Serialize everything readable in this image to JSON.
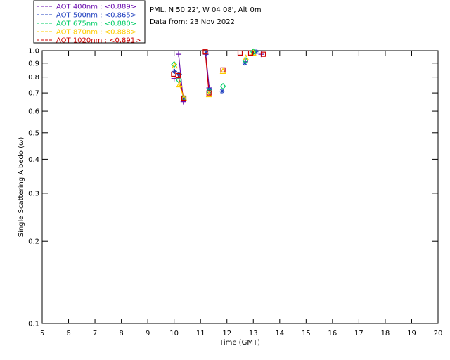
{
  "info": {
    "site": "PML, N 50 22', W 04 08', Alt 0m",
    "date": "Data from: 23 Nov 2022"
  },
  "legend": [
    {
      "label": "AOT  400nm : <0.889>",
      "color": "#6a0dad"
    },
    {
      "label": "AOT  500nm : <0.865>",
      "color": "#1f3fbf"
    },
    {
      "label": "AOT  675nm : <0.880>",
      "color": "#00cc66"
    },
    {
      "label": "AOT  870nm : <0.888>",
      "color": "#ffcc00"
    },
    {
      "label": "AOT 1020nm : <0.891>",
      "color": "#cc0000"
    }
  ],
  "chart_data": {
    "type": "scatter",
    "title": "",
    "xlabel": "Time (GMT)",
    "ylabel": "Single Scattering Albedo (ω)",
    "xlim": [
      5,
      20
    ],
    "ylim": [
      0.1,
      1.0
    ],
    "yscale": "log",
    "x_ticks": [
      "5",
      "6",
      "7",
      "8",
      "9",
      "10",
      "11",
      "12",
      "13",
      "14",
      "15",
      "16",
      "17",
      "18",
      "19",
      "20"
    ],
    "y_ticks": [
      {
        "value": 1.0,
        "label": "1.0"
      },
      {
        "value": 0.9,
        "label": "0.9"
      },
      {
        "value": 0.8,
        "label": "0.8"
      },
      {
        "value": 0.7,
        "label": "0.7"
      },
      {
        "value": 0.6,
        "label": "0.6"
      },
      {
        "value": 0.5,
        "label": "0.5"
      },
      {
        "value": 0.4,
        "label": "0.4"
      },
      {
        "value": 0.3,
        "label": "0.3"
      },
      {
        "value": 0.2,
        "label": "0.2"
      },
      {
        "value": 0.1,
        "label": "0.1"
      }
    ],
    "series": [
      {
        "name": "AOT  400nm : <0.889>",
        "marker": "plus",
        "x": [
          10.0,
          10.17,
          10.35,
          11.2,
          11.33,
          12.7,
          13.3
        ],
        "y": [
          0.79,
          0.97,
          0.65,
          0.97,
          0.73,
          0.91,
          0.97
        ]
      },
      {
        "name": "AOT  500nm : <0.865>",
        "marker": "star",
        "x": [
          10.02,
          10.2,
          10.36,
          11.22,
          11.34,
          11.82,
          12.68,
          13.1
        ],
        "y": [
          0.84,
          0.82,
          0.67,
          0.98,
          0.72,
          0.71,
          0.9,
          0.99
        ]
      },
      {
        "name": "AOT  675nm : <0.880>",
        "marker": "diamond",
        "x": [
          10.0,
          10.18,
          10.36,
          11.33,
          11.85,
          12.7,
          13.0
        ],
        "y": [
          0.89,
          0.78,
          0.67,
          0.71,
          0.74,
          0.92,
          0.99
        ]
      },
      {
        "name": "AOT  870nm : <0.888>",
        "marker": "triangle",
        "x": [
          10.02,
          10.2,
          10.37,
          11.32,
          11.85,
          12.72,
          13.0
        ],
        "y": [
          0.88,
          0.75,
          0.67,
          0.69,
          0.84,
          0.94,
          0.98
        ]
      },
      {
        "name": "AOT 1020nm : <0.891>",
        "marker": "square",
        "x": [
          9.98,
          10.15,
          10.37,
          11.18,
          11.32,
          11.85,
          12.5,
          12.9,
          13.38
        ],
        "y": [
          0.82,
          0.81,
          0.67,
          0.99,
          0.7,
          0.85,
          0.98,
          0.98,
          0.97
        ]
      }
    ],
    "segments": [
      {
        "color": "#6a0dad",
        "x": [
          10.17,
          10.35
        ],
        "y": [
          0.97,
          0.65
        ]
      },
      {
        "color": "#6a0dad",
        "x": [
          11.2,
          11.33
        ],
        "y": [
          0.97,
          0.73
        ]
      },
      {
        "color": "#cc0000",
        "x": [
          10.15,
          10.37
        ],
        "y": [
          0.81,
          0.67
        ]
      },
      {
        "color": "#cc0000",
        "x": [
          11.18,
          11.32
        ],
        "y": [
          0.99,
          0.7
        ]
      },
      {
        "color": "#ffcc00",
        "x": [
          10.2,
          10.37
        ],
        "y": [
          0.75,
          0.67
        ]
      }
    ]
  }
}
